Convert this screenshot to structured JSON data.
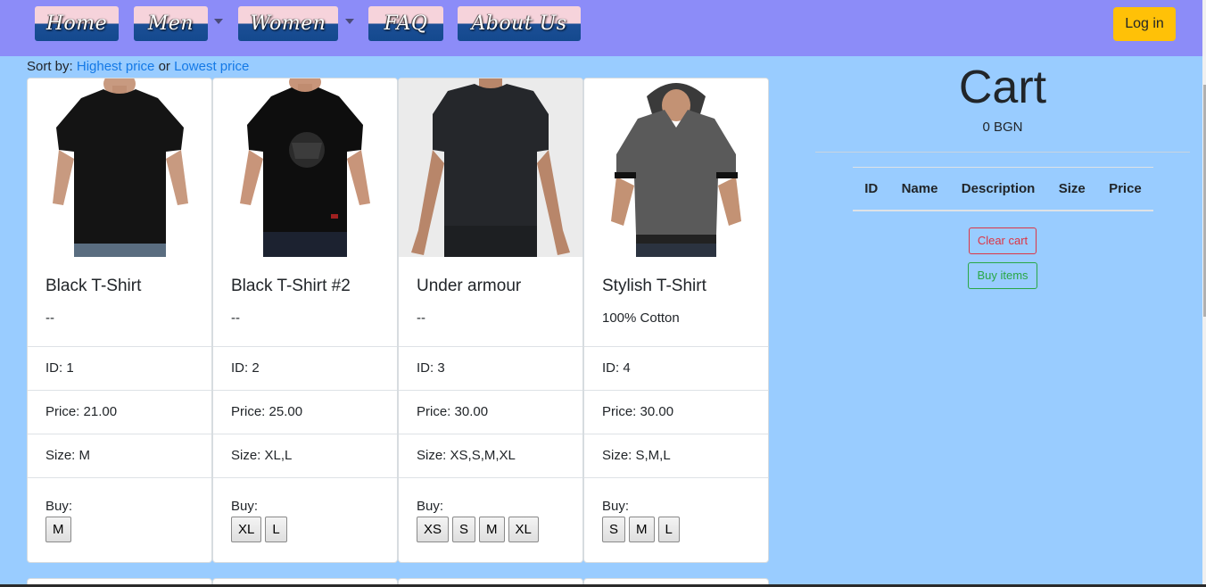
{
  "nav": {
    "items": [
      "Home",
      "Men",
      "Women",
      "FAQ",
      "About Us"
    ],
    "login_label": "Log in",
    "colors": {
      "bar": "#8c8cf8",
      "login": "#ffc107"
    }
  },
  "sort": {
    "prefix": "Sort by:",
    "highest": "Highest price",
    "or": "or",
    "lowest": "Lowest price"
  },
  "products": [
    {
      "title": "Black T-Shirt",
      "desc": "--",
      "id": "ID: 1",
      "price": "Price: 21.00",
      "size": "Size: M",
      "buy_label": "Buy:",
      "sizes": [
        "M"
      ],
      "image": "black-tshirt-photo"
    },
    {
      "title": "Black T-Shirt #2",
      "desc": "--",
      "id": "ID: 2",
      "price": "Price: 25.00",
      "size": "Size: XL,L",
      "buy_label": "Buy:",
      "sizes": [
        "XL",
        "L"
      ],
      "image": "black-graphic-tshirt-photo"
    },
    {
      "title": "Under armour",
      "desc": "--",
      "id": "ID: 3",
      "price": "Price: 30.00",
      "size": "Size: XS,S,M,XL",
      "buy_label": "Buy:",
      "sizes": [
        "XS",
        "S",
        "M",
        "XL"
      ],
      "image": "under-armour-tshirt-photo"
    },
    {
      "title": "Stylish T-Shirt",
      "desc": "100% Cotton",
      "id": "ID: 4",
      "price": "Price: 30.00",
      "size": "Size: S,M,L",
      "buy_label": "Buy:",
      "sizes": [
        "S",
        "M",
        "L"
      ],
      "image": "hooded-tshirt-photo"
    }
  ],
  "cart": {
    "title": "Cart",
    "total": "0 BGN",
    "columns": [
      "ID",
      "Name",
      "Description",
      "Size",
      "Price"
    ],
    "clear_label": "Clear cart",
    "buy_label": "Buy items"
  }
}
